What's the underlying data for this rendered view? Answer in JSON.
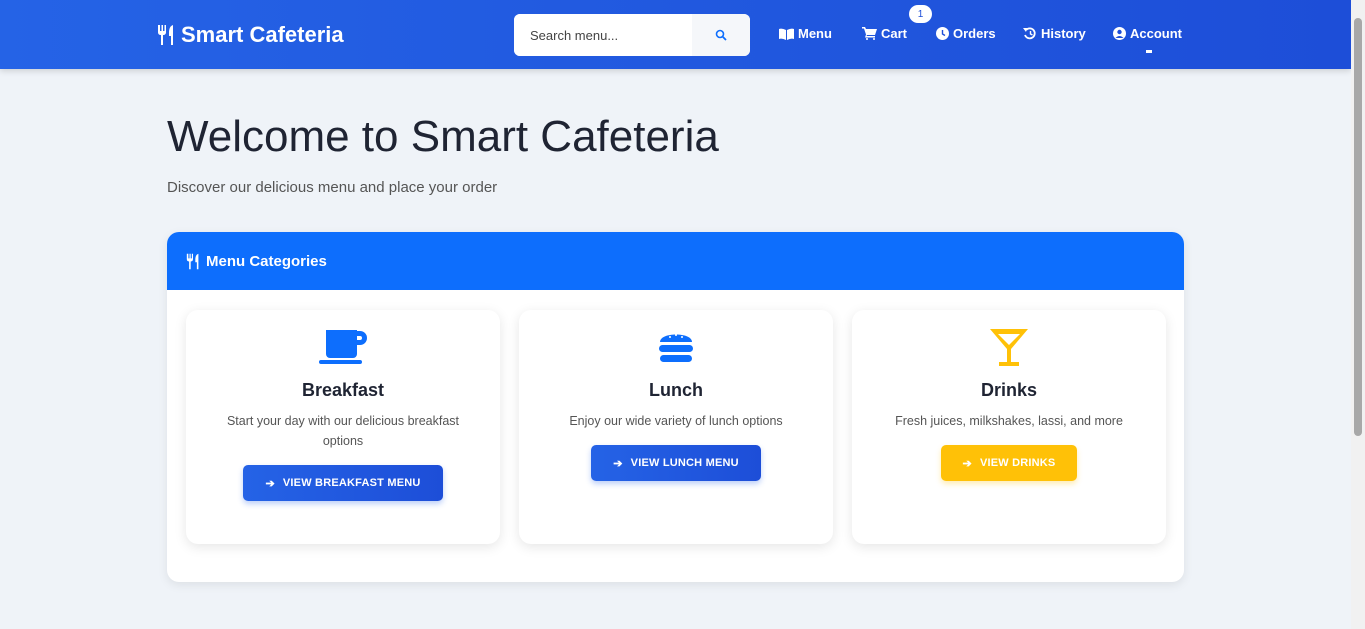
{
  "nav": {
    "brand": "Smart Cafeteria",
    "search_placeholder": "Search menu...",
    "links": [
      {
        "label": "Menu"
      },
      {
        "label": "Cart"
      },
      {
        "label": "Orders"
      },
      {
        "label": "History"
      },
      {
        "label": "Account"
      }
    ],
    "cart_count": "1"
  },
  "hero": {
    "title": "Welcome to Smart Cafeteria",
    "subtitle": "Discover our delicious menu and place your order"
  },
  "panel": {
    "title": "Menu Categories",
    "cards": [
      {
        "title": "Breakfast",
        "desc": "Start your day with our delicious breakfast options",
        "button": "VIEW BREAKFAST MENU"
      },
      {
        "title": "Lunch",
        "desc": "Enjoy our wide variety of lunch options",
        "button": "VIEW LUNCH MENU"
      },
      {
        "title": "Drinks",
        "desc": "Fresh juices, milkshakes, lassi, and more",
        "button": "VIEW DRINKS"
      }
    ]
  },
  "colors": {
    "primary": "#0d6efd",
    "nav": "#1d4ed8",
    "warning": "#ffc107"
  }
}
